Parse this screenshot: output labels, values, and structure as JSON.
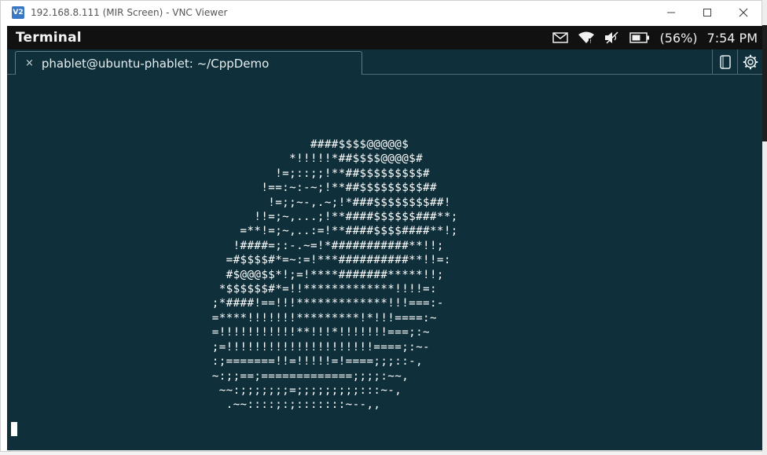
{
  "vnc": {
    "logo": "V2",
    "title": "192.168.8.111 (MIR Screen) - VNC Viewer"
  },
  "panel": {
    "app_name": "Terminal",
    "battery": "(56%)",
    "clock": "7:54 PM"
  },
  "tab": {
    "close_glyph": "×",
    "label": "phablet@ubuntu-phablet: ~/CppDemo"
  },
  "terminal": {
    "ascii_lines": [
      "                  ####$$$$@@@@@$",
      "               *!!!!!*##$$$$@@@@$#",
      "             !=;::;;!**##$$$$$$$$$#",
      "           !==:~:-~;!**##$$$$$$$$$##",
      "            !=;;~-,.~;!*###$$$$$$$$##!",
      "          !!=;~,...;!**####$$$$$$###**;",
      "        =**!=;~,..:=!**####$$$$####**!;",
      "       !####=;:-.~=!*###########**!!;",
      "      =#$$$$#*=~:=!***##########**!!=:",
      "      #$@@@$$*!;=!****#######*****!!;",
      "     *$$$$$$#*=!!*************!!!!=:",
      "    ;*####!==!!!*************!!!===:-",
      "    =****!!!!!!!*********!*!!!====:~",
      "    =!!!!!!!!!!!**!!!*!!!!!!!===;:~",
      "    ;=!!!!!!!!!!!!!!!!!!!!!====;:~-",
      "    :;=======!!=!!!!!=!====;;;::-,",
      "    ~:;;==;=============;;;;:~~,",
      "     ~~:;;;;;;;=;;;;;;;;;:::~-,",
      "      .~~::::;:;:::::::~--,,"
    ]
  },
  "icons": {
    "message": "envelope-icon",
    "wifi": "wifi-icon",
    "volume": "volume-muted-icon",
    "battery": "battery-icon",
    "new_tab": "new-tab-icon",
    "settings": "gear-icon"
  },
  "colors": {
    "terminal_bg": "#0f2f3a",
    "panel_bg": "#111111",
    "text": "#ffffff"
  }
}
